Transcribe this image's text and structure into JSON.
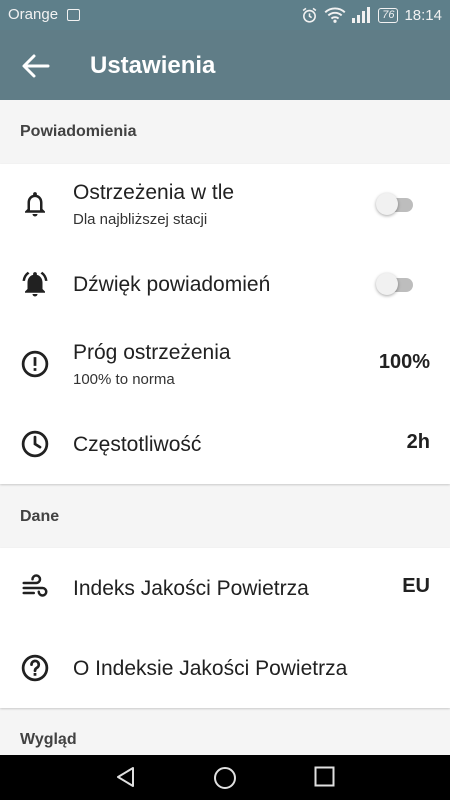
{
  "status_bar": {
    "carrier": "Orange",
    "battery": "76",
    "time": "18:14",
    "icons": [
      "image-icon",
      "alarm-icon",
      "wifi-icon",
      "signal-icon",
      "battery-icon"
    ]
  },
  "app_bar": {
    "title": "Ustawienia",
    "background": "#607d87"
  },
  "sections": {
    "notifications": {
      "header": "Powiadomienia",
      "items": [
        {
          "icon": "bell-icon",
          "title": "Ostrzeżenia w tle",
          "subtitle": "Dla najbliższej stacji",
          "control": "toggle",
          "enabled": false
        },
        {
          "icon": "bell-ringing-icon",
          "title": "Dźwięk powiadomień",
          "control": "toggle",
          "enabled": false
        },
        {
          "icon": "alert-circle-icon",
          "title": "Próg ostrzeżenia",
          "subtitle": "100% to norma",
          "value": "100%"
        },
        {
          "icon": "clock-icon",
          "title": "Częstotliwość",
          "value": "2h"
        }
      ]
    },
    "data": {
      "header": "Dane",
      "items": [
        {
          "icon": "wind-icon",
          "title": "Indeks Jakości Powietrza",
          "value": "EU"
        },
        {
          "icon": "help-circle-icon",
          "title": "O Indeksie Jakości Powietrza"
        }
      ]
    },
    "appearance": {
      "header": "Wygląd"
    }
  },
  "nav_bar": {
    "icons": [
      "back-triangle-icon",
      "home-circle-icon",
      "recents-square-icon"
    ]
  }
}
